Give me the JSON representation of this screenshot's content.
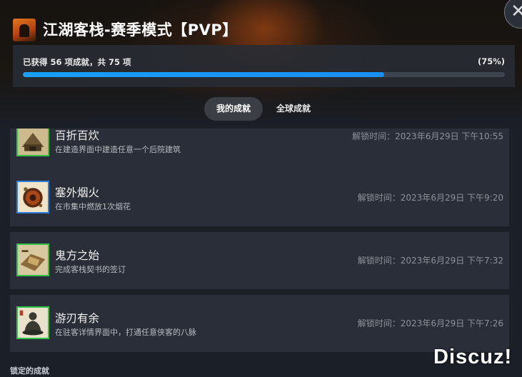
{
  "header": {
    "title": "江湖客栈-赛季模式【PVP】",
    "progress": {
      "text": "已获得 56 项成就，共 75 项",
      "percent_label": "(75%)",
      "percent": 75
    },
    "tabs": [
      {
        "label": "我的成就",
        "active": true
      },
      {
        "label": "全球成就",
        "active": false
      }
    ],
    "close_icon": "close-icon"
  },
  "achievements": [
    {
      "name": "百折百炊",
      "description": "在建造界面中建造任意一个后院建筑",
      "unlock_time": "解锁时间：2023年6月29日 下午10:55",
      "icon": "building-icon"
    },
    {
      "name": "塞外烟火",
      "description": "在市集中燃放1次烟花",
      "unlock_time": "解锁时间：2023年6月29日 下午9:20",
      "icon": "firework-icon"
    },
    {
      "name": "鬼方之始",
      "description": "完成客栈契书的签订",
      "unlock_time": "解锁时间：2023年6月29日 下午7:32",
      "icon": "contract-icon"
    },
    {
      "name": "游刃有余",
      "description": "在驻客详情界面中，打通任意侠客的八脉",
      "unlock_time": "解锁时间：2023年6月29日 下午7:26",
      "icon": "meditation-icon"
    }
  ],
  "locked_section_label": "锁定的成就",
  "watermark": "Discuz!",
  "colors": {
    "progress_fill": "#1a9fff",
    "icon_border_green": "#35c04a",
    "icon_border_blue": "#2e7fd9"
  }
}
